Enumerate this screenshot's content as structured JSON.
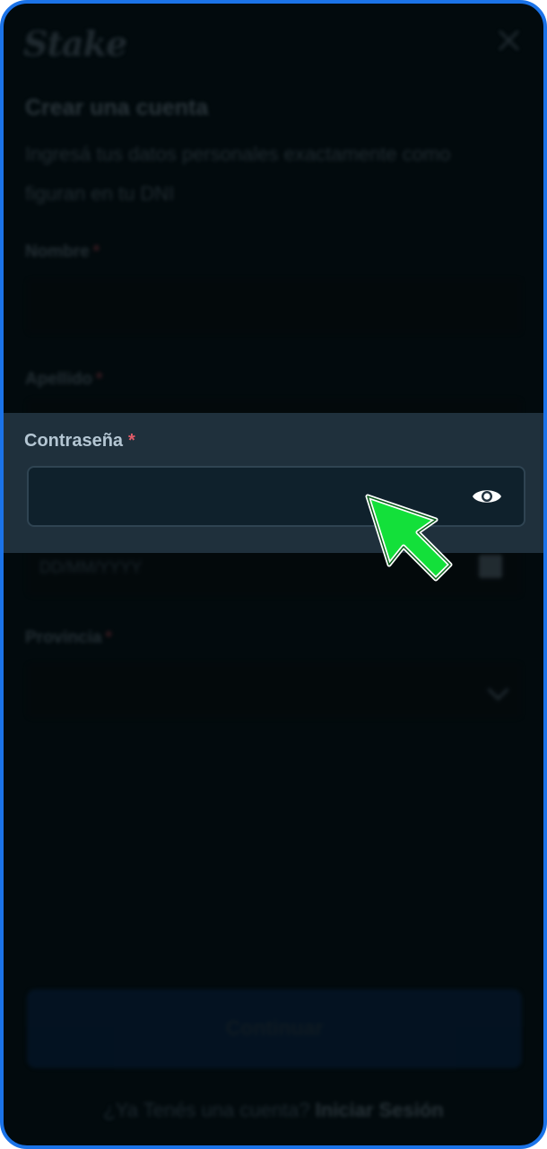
{
  "brand": {
    "logo_text": "Stake"
  },
  "form": {
    "title": "Crear una cuenta",
    "subtitle": "Ingresá tus datos personales exactamente como figuran en tu DNI",
    "fields": {
      "nombre": {
        "label": "Nombre",
        "required_mark": "*"
      },
      "apellido": {
        "label": "Apellido",
        "required_mark": "*"
      },
      "password": {
        "label": "Contraseña",
        "required_mark": "*",
        "value": ""
      },
      "fecha": {
        "placeholder": "DD/MM/YYYY"
      },
      "provincia": {
        "label": "Provincia",
        "required_mark": "*"
      }
    },
    "continue_label": "Continuar",
    "login_prompt": "¿Ya Tenés una cuenta?",
    "login_link": "Iniciar Sesión"
  },
  "icons": {
    "close": "close-icon",
    "eye": "eye-icon",
    "calendar": "calendar-icon",
    "chevron": "chevron-down-icon",
    "cursor": "pointer-cursor-icon"
  },
  "colors": {
    "frame_border": "#1b73e8",
    "highlight_bg": "#1f303c",
    "required": "#e35c69",
    "cursor_fill": "#13e03a"
  }
}
